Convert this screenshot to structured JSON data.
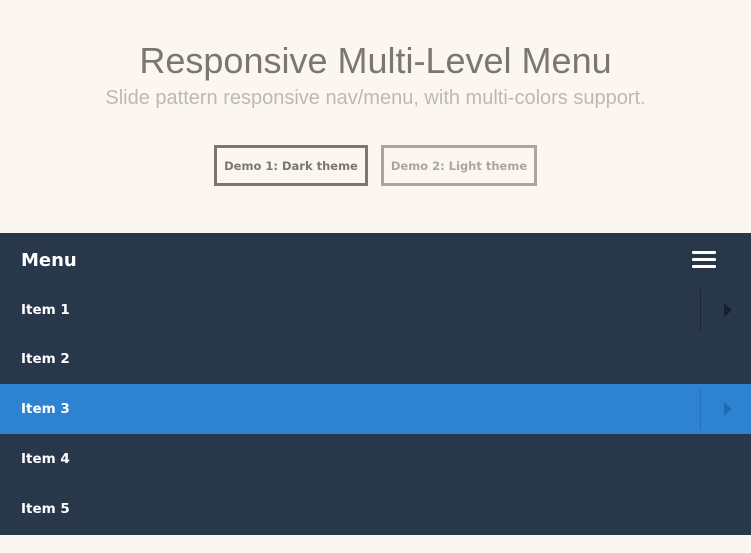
{
  "header": {
    "title": "Responsive Multi-Level Menu",
    "subtitle": "Slide pattern responsive nav/menu, with multi-colors support.",
    "demo_dark_label": "Demo 1: Dark theme",
    "demo_light_label": "Demo 2: Light theme"
  },
  "menu": {
    "title": "Menu",
    "toggle_icon": "hamburger-icon",
    "items": [
      {
        "label": "Item 1",
        "has_submenu": true,
        "active": false
      },
      {
        "label": "Item 2",
        "has_submenu": false,
        "active": false
      },
      {
        "label": "Item 3",
        "has_submenu": true,
        "active": true
      },
      {
        "label": "Item 4",
        "has_submenu": false,
        "active": false
      },
      {
        "label": "Item 5",
        "has_submenu": false,
        "active": false
      }
    ],
    "submenu_icon": "chevron-right-icon"
  },
  "colors": {
    "page_background": "#fbf7f0",
    "menu_background": "#28374a",
    "active_item": "#2e82d2",
    "title_text": "#7b7670",
    "subtitle_text": "#bdb8b0"
  }
}
